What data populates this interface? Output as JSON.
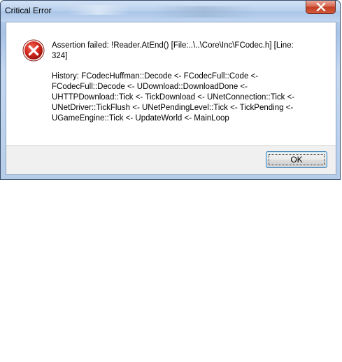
{
  "window": {
    "title": "Critical Error",
    "close_icon": "close-icon"
  },
  "dialog": {
    "icon": "error-icon",
    "icon_color": "#c8281e",
    "message_lines": [
      "Assertion failed: !Reader.AtEnd() [File:..\\..\\Core\\Inc\\FCodec.h] [Line:",
      "324]"
    ],
    "history_lines": [
      "History: FCodecHuffman::Decode <- FCodecFull::Code <-",
      "FCodecFull::Decode <- UDownload::DownloadDone <-",
      "UHTTPDownload::Tick <- TickDownload <- UNetConnection::Tick <-",
      "UNetDriver::TickFlush <- UNetPendingLevel::Tick <- TickPending <-",
      "UGameEngine::Tick <- UpdateWorld <- MainLoop"
    ]
  },
  "buttons": {
    "ok_label": "OK"
  },
  "colors": {
    "close_button": "#c23f22",
    "ok_border": "#3c7fb1"
  }
}
